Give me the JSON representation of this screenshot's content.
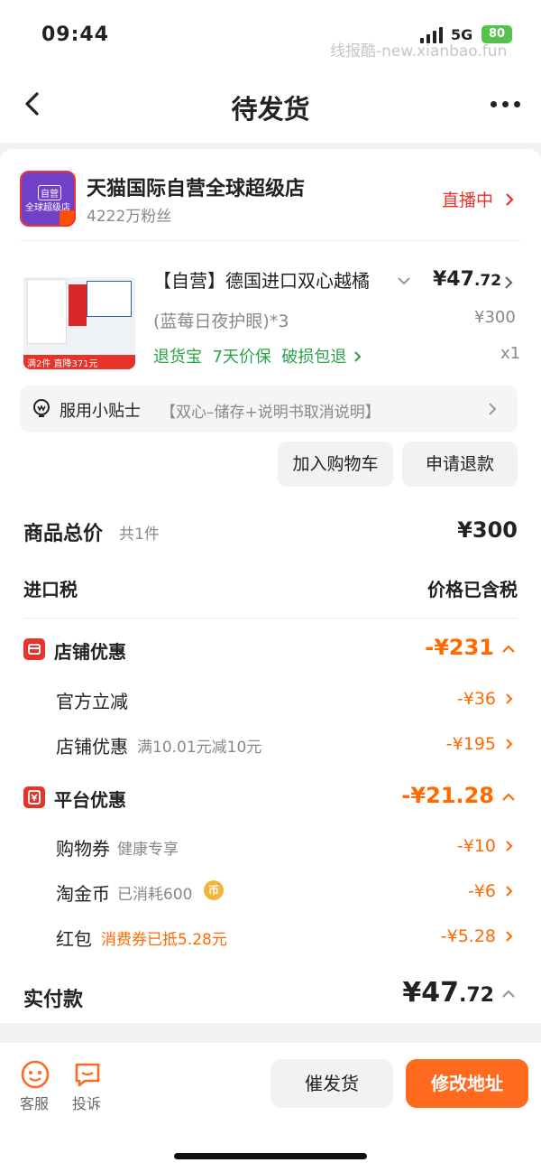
{
  "status_bar": {
    "time": "09:44",
    "network": "5G",
    "battery": "80",
    "watermark": "线报酷-new.xianbao.fun"
  },
  "nav": {
    "title": "待发货",
    "back_icon": "chevron-left-icon",
    "more_icon": "more-dots-icon"
  },
  "store": {
    "logo_tag": "自营",
    "logo_sub": "全球超级店",
    "name": "天猫国际自营全球超级店",
    "fans": "4222万粉丝",
    "live": "直播中"
  },
  "product": {
    "title": "【自营】德国进口双心越橘",
    "price_int": "¥47",
    "price_dec": ".72",
    "spec": "(蓝莓日夜护眼)*3",
    "original_price": "¥300",
    "services": "退货宝  7天价保  破损包退",
    "qty": "x1",
    "img_banner": "满2件 直降371元"
  },
  "tips": {
    "label": "服用小贴士",
    "desc": "【双心–储存+说明书取消说明】"
  },
  "actions": {
    "add_cart": "加入购物车",
    "refund": "申请退款"
  },
  "summary": {
    "total_label": "商品总价",
    "total_count": "共1件",
    "total_value": "¥300",
    "tax_label": "进口税",
    "tax_value": "价格已含税",
    "store_discount_label": "店铺优惠",
    "store_discount_value": "-¥231",
    "official_cut_label": "官方立减",
    "official_cut_value": "-¥36",
    "store_coupon_label": "店铺优惠",
    "store_coupon_desc": "满10.01元减10元",
    "store_coupon_value": "-¥195",
    "platform_label": "平台优惠",
    "platform_value": "-¥21.28",
    "shopping_coupon_label": "购物券",
    "shopping_coupon_desc": "健康专享",
    "shopping_coupon_value": "-¥10",
    "taojinbi_label": "淘金币",
    "taojinbi_desc": "已消耗600",
    "taojinbi_coin": "币",
    "taojinbi_value": "-¥6",
    "redpacket_label": "红包",
    "redpacket_desc": "消费券已抵5.28元",
    "redpacket_value": "-¥5.28",
    "paid_label": "实付款",
    "paid_int": "¥47",
    "paid_dec": ".72"
  },
  "bottom": {
    "service": "客服",
    "complain": "投诉",
    "urge": "催发货",
    "change_address": "修改地址"
  },
  "colors": {
    "accent": "#ff6a1e",
    "red": "#e8332a",
    "green": "#2aa24a"
  }
}
